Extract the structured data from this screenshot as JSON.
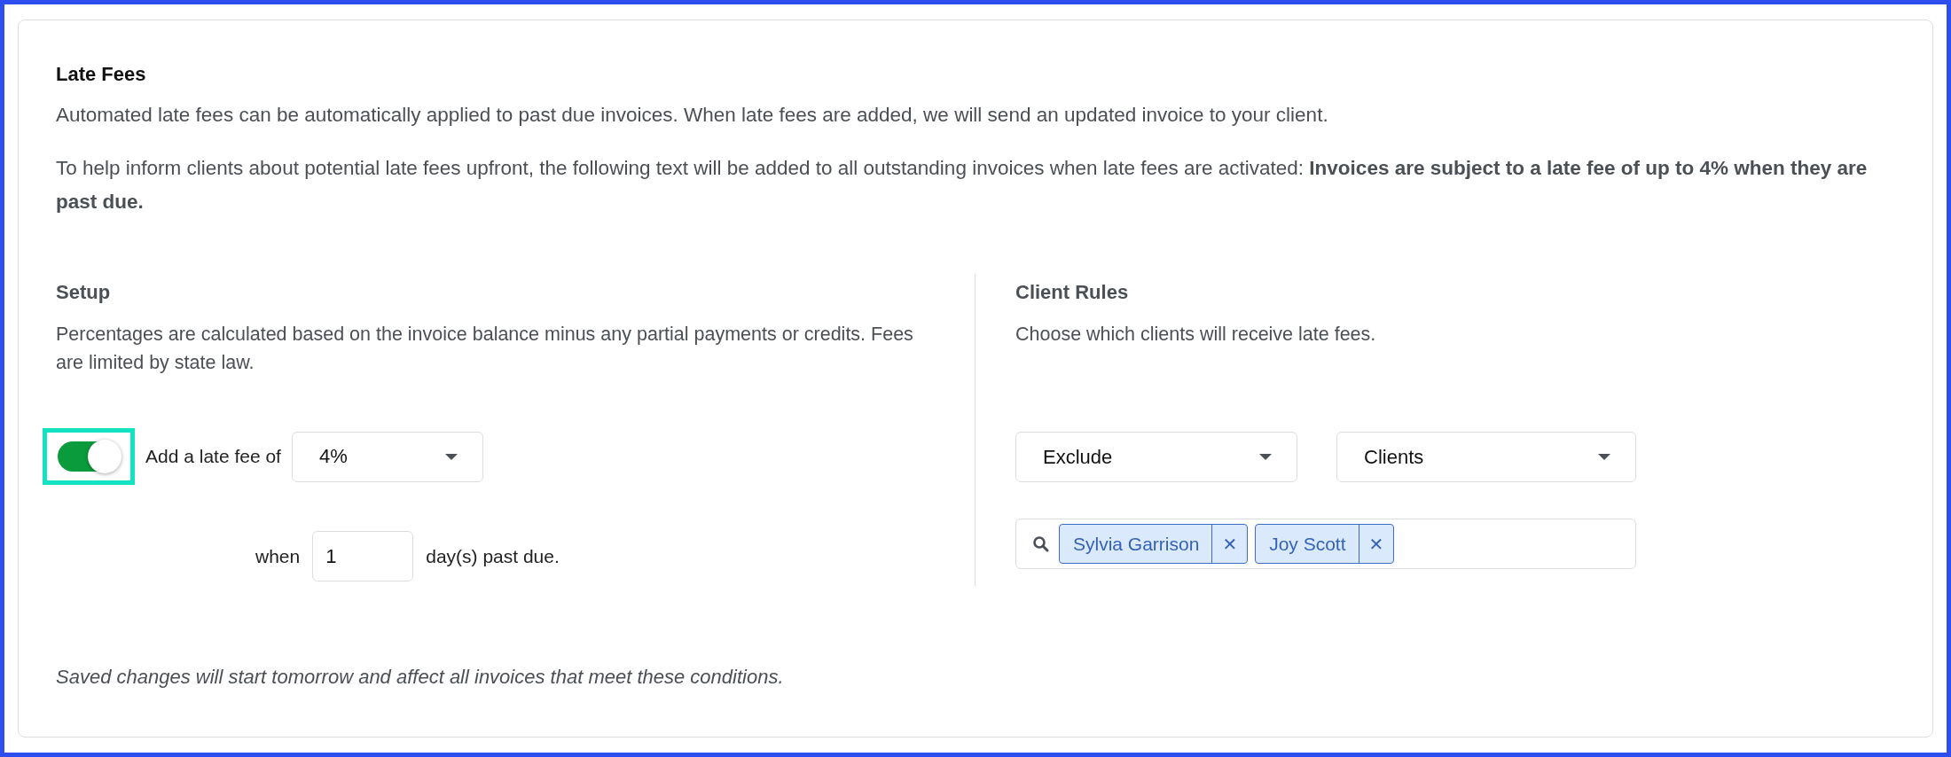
{
  "title": "Late Fees",
  "paragraphs": [
    "Automated late fees can be automatically applied to past due invoices. When late fees are added, we will send an updated invoice to your client.",
    "To help inform clients about potential late fees upfront, the following text will be added to all outstanding invoices when late fees are activated: **Invoices are subject to a late fee of up to 4% when they are past due.**"
  ],
  "setup": {
    "heading": "Setup",
    "description": "Percentages are calculated based on the invoice balance minus any partial payments or credits. Fees are limited by state law.",
    "toggle": {
      "on": true,
      "focused": true
    },
    "fee_label": "Add a late fee of",
    "fee_select": {
      "value": "4%"
    },
    "when_label": "when",
    "days_field": {
      "value": "1"
    },
    "days_suffix": "day(s) past due."
  },
  "client_rules": {
    "heading": "Client Rules",
    "description": "Choose which clients will receive late fees.",
    "mode_select": {
      "value": "Exclude"
    },
    "target_select": {
      "value": "Clients"
    },
    "tags": [
      {
        "label": "Sylvia Garrison",
        "remove": "✕"
      },
      {
        "label": "Joy Scott",
        "remove": "✕"
      }
    ]
  },
  "footer_note": "Saved changes will start tomorrow and affect all invoices that meet these conditions."
}
